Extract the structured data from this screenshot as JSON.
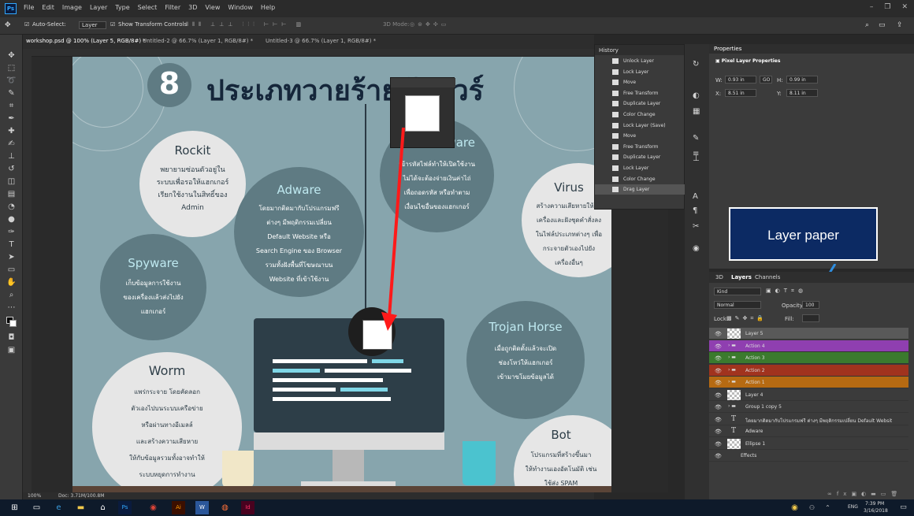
{
  "app": {
    "logo": "Ps",
    "menu": [
      "File",
      "Edit",
      "Image",
      "Layer",
      "Type",
      "Select",
      "Filter",
      "3D",
      "View",
      "Window",
      "Help"
    ]
  },
  "options": {
    "auto_select": "Auto-Select:",
    "layer_select": "Layer",
    "show_transform": "Show Transform Controls",
    "mode_3d": "3D Mode:"
  },
  "tabs": [
    "workshop.psd @ 100% (Layer 5, RGB/8#) *",
    "Untitled-2 @ 66.7% (Layer 1, RGB/8#) *",
    "Untitled-3 @ 66.7% (Layer 1, RGB/8#) *"
  ],
  "artwork": {
    "title_number": "8",
    "title": "ประเภทวายร้ายมัลแวร์",
    "rockit": {
      "name": "Rockit",
      "lines": [
        "พยายามซ่อนตัวอยู่ใน",
        "ระบบเพื่อรอให้แฮกเกอร์",
        "เรียกใช้งานในสิทธิ์ของ",
        "Admin"
      ]
    },
    "adware": {
      "name": "Adware",
      "lines": [
        "โดยมากติดมากับโปรแกรมฟรี",
        "ต่างๆ มีพฤติกรรมเปลี่ยน",
        "Default Website หรือ",
        "Search Engine ของ Browser",
        "รวมทั้งฝังพื้นที่โฆษณาบน",
        "Website ที่เข้าใช้งาน"
      ]
    },
    "ransomware": {
      "name": "Ransomware",
      "lines": [
        "เข้ารหัสไฟล์ทำให้เปิดใช้งาน",
        "ไม่ได้จะต้องจ่ายเงินค่าไถ่",
        "เพื่อถอดรหัส หรือทำตาม",
        "เงื่อนไขอื่นของแฮกเกอร์"
      ]
    },
    "virus": {
      "name": "Virus",
      "lines": [
        "สร้างความเสียหายให้กับ",
        "เครื่องและฝังชุดคำสั่งลง",
        "ในไฟล์ประเภทต่างๆ เพื่อ",
        "กระจายตัวเองไปยัง",
        "เครื่องอื่นๆ"
      ]
    },
    "spyware": {
      "name": "Spyware",
      "lines": [
        "เก็บข้อมูลการใช้งาน",
        "ของเครื่องแล้วส่งไปยัง",
        "แฮกเกอร์"
      ]
    },
    "trojan": {
      "name": "Trojan Horse",
      "lines": [
        "เมื่อถูกติดตั้งแล้วจะเปิด",
        "ช่องโหว่ให้แฮกเกอร์",
        "เข้ามาขโมยข้อมูลได้"
      ]
    },
    "worm": {
      "name": "Worm",
      "lines": [
        "แพร่กระจาย โดยคัดลอก",
        "ตัวเองไปบนระบบเครือข่าย",
        "หรือผ่านทางอีเมลล์",
        "และสร้างความเสียหาย",
        "ให้กับข้อมูลรวมทั้งอาจทำให้",
        "ระบบหยุดการทำงาน"
      ]
    },
    "bot": {
      "name": "Bot",
      "lines": [
        "โปรแกรมที่สร้างขึ้นมา",
        "ให้ทำงานเองอัตโนมัติ เช่น",
        "ใช้ส่ง SPAM"
      ]
    }
  },
  "callout": {
    "label": "Layer paper",
    "color": "#0c2a63"
  },
  "history": {
    "title": "History",
    "items": [
      "Unlock Layer",
      "Lock Layer",
      "Move",
      "Free Transform",
      "Duplicate Layer",
      "Color Change",
      "Lock Layer (Save)",
      "Move",
      "Free Transform",
      "Duplicate Layer",
      "Lock Layer",
      "Color Change",
      "Drag Layer"
    ]
  },
  "properties": {
    "title": "Properties",
    "subtitle": "Pixel Layer Properties",
    "w_label": "W:",
    "w_value": "0.93 in",
    "go_label": "GO",
    "h_label": "H:",
    "h_value": "0.99 in",
    "x_label": "X:",
    "x_value": "8.51 in",
    "y_label": "Y:",
    "y_value": "8.11 in"
  },
  "layers_panel": {
    "tabs": [
      "3D",
      "Layers",
      "Channels"
    ],
    "kind": "Kind",
    "blend": "Normal",
    "opacity_label": "Opacity:",
    "opacity_value": "100",
    "lock_label": "Lock:",
    "fill_label": "Fill:",
    "rows": [
      {
        "name": "Layer 5",
        "type": "pixel",
        "color": "#595959"
      },
      {
        "name": "Action 4",
        "type": "group",
        "color": "#8f3fb0"
      },
      {
        "name": "Action 3",
        "type": "group",
        "color": "#3b7a2e"
      },
      {
        "name": "Action 2",
        "type": "group",
        "color": "#a1331e"
      },
      {
        "name": "Action 1",
        "type": "group",
        "color": "#b66a12"
      },
      {
        "name": "Layer 4",
        "type": "pixel",
        "color": "#3b3b3b"
      },
      {
        "name": "Group 1 copy 5",
        "type": "group",
        "color": "#3b3b3b"
      },
      {
        "name": "โดยมากติดมากับโปรแกรมฟรี ต่างๆ มีพฤติกรรมเปลี่ยน Default Websit",
        "type": "text",
        "color": "#3b3b3b"
      },
      {
        "name": "Adware",
        "type": "text",
        "color": "#3b3b3b"
      },
      {
        "name": "Ellipse 1",
        "type": "shape",
        "color": "#3b3b3b"
      },
      {
        "name": "Effects",
        "type": "effects",
        "color": "#3b3b3b"
      }
    ]
  },
  "status": {
    "zoom": "100%",
    "doc": "Doc: 3.71M/100.8M"
  },
  "taskbar": {
    "time": "7:39 PM",
    "date": "3/16/2018",
    "lang": "ENG"
  }
}
